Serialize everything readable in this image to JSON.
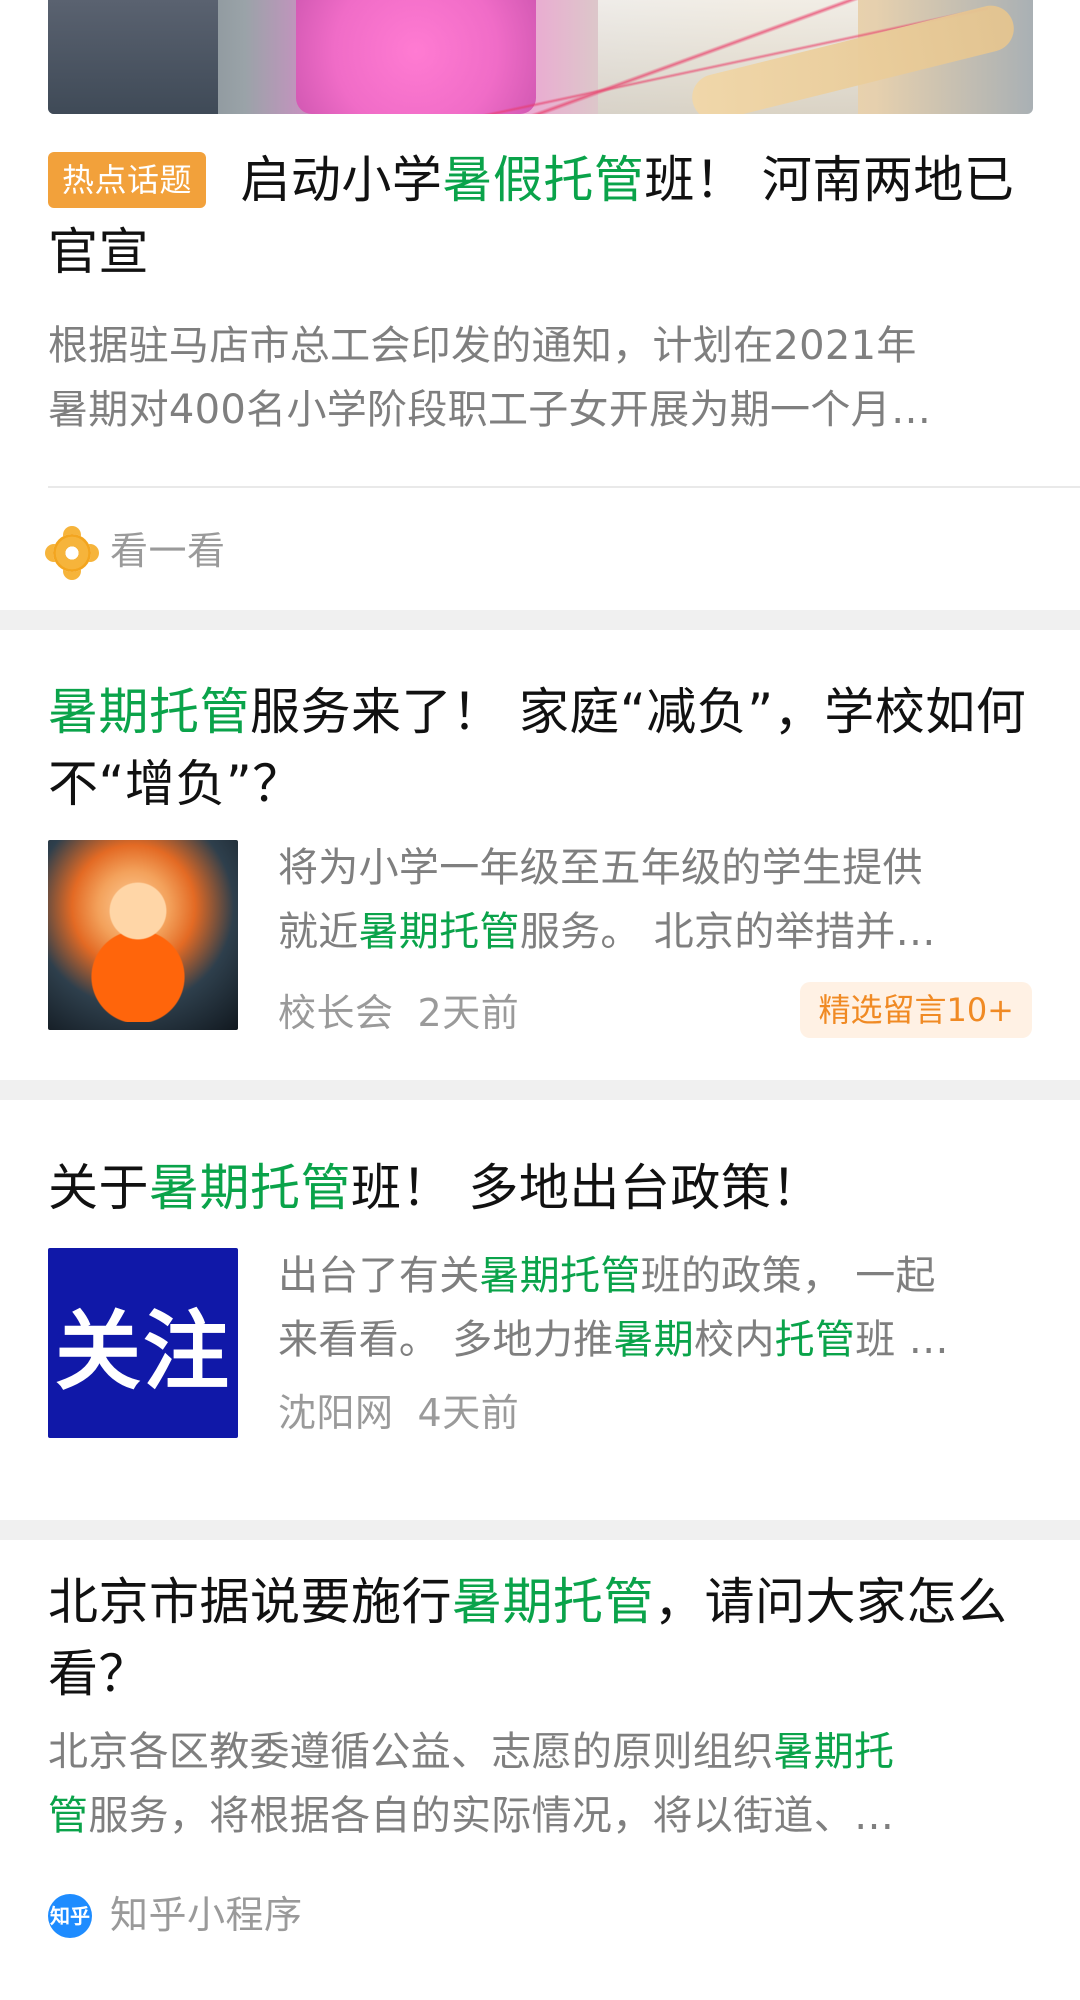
{
  "items": [
    {
      "badge": "热点话题",
      "title_parts": [
        "启动小学",
        "暑假托管",
        "班！ 河南两地已"
      ],
      "title_line2": "官宣",
      "desc_lines": [
        "根据驻马店市总工会印发的通知，计划在2021年",
        "暑期对400名小学阶段职工子女开展为期一个月…"
      ],
      "source": "看一看",
      "source_icon": "kanyikan-icon"
    },
    {
      "title_line1_parts": [
        "暑期托管",
        "服务来了！ 家庭“减负”，学校如何"
      ],
      "title_line2": "不“增负”？",
      "desc_line1": "将为小学一年级至五年级的学生提供",
      "desc_line2_parts": [
        "就近",
        "暑期托管",
        "服务。 北京的举措并…"
      ],
      "source": "校长会",
      "time": "2天前",
      "tag": "精选留言10+"
    },
    {
      "title_parts": [
        "关于",
        "暑期托管",
        "班！ 多地出台政策！"
      ],
      "thumb_text": "关注",
      "desc_line1_parts": [
        "出台了有关",
        "暑期托管",
        "班的政策， 一起"
      ],
      "desc_line2_parts": [
        "来看看。 多地力推",
        "暑期",
        "校内",
        "托管",
        "班 …"
      ],
      "source": "沈阳网",
      "time": "4天前"
    },
    {
      "title_parts": [
        "北京市据说要施行",
        "暑期托管",
        "，请问大家怎么"
      ],
      "title_line2": "看？",
      "desc_line1_parts": [
        "北京各区教委遵循公益、志愿的原则组织",
        "暑期托"
      ],
      "desc_line2_parts": [
        "管",
        "服务，将根据各自的实际情况，将以街道、…"
      ],
      "source": "知乎小程序",
      "source_icon_text": "知乎"
    }
  ],
  "colors": {
    "highlight": "#0aa34a",
    "badge_bg": "#f2a13b",
    "pill_bg": "#fff1e4",
    "pill_text": "#f08a24",
    "meta": "#9a9a9a",
    "desc": "#7f7f7f"
  }
}
